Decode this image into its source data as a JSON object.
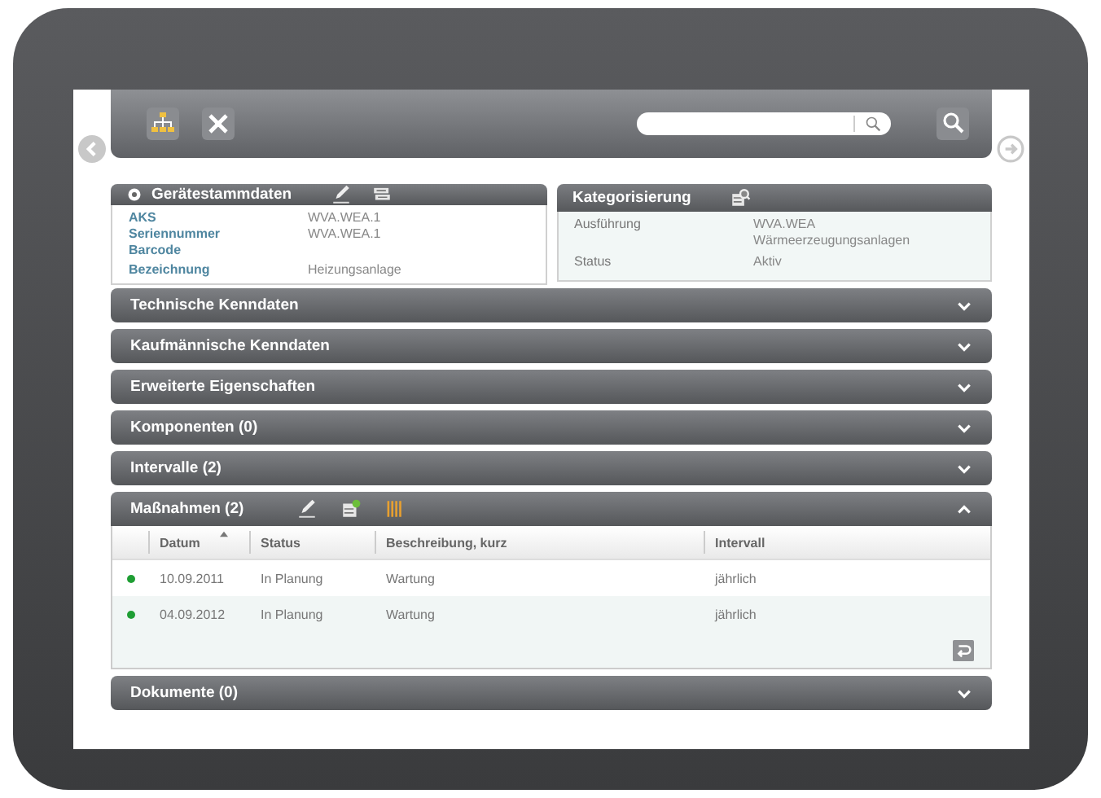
{
  "device_card": {
    "title": "Gerätestammdaten",
    "fields": [
      {
        "label": "AKS",
        "value": "WVA.WEA.1"
      },
      {
        "label": "Seriennummer",
        "value": "WVA.WEA.1"
      },
      {
        "label": "Barcode"
      },
      {
        "label": "Bezeichnung",
        "value": "Heizungsanlage"
      }
    ]
  },
  "category_card": {
    "title": "Kategorisierung",
    "fields": [
      {
        "label": "Ausführung",
        "value": "WVA.WEA\nWärmeerzeugungsanlagen"
      },
      {
        "label": "Status",
        "value": "Aktiv"
      }
    ]
  },
  "sections": [
    {
      "title": "Technische Kenndaten",
      "expanded": false
    },
    {
      "title": "Kaufmännische Kenndaten",
      "expanded": false
    },
    {
      "title": "Erweiterte Eigenschaften",
      "expanded": false
    },
    {
      "title": "Komponenten (0)",
      "expanded": false
    },
    {
      "title": "Intervalle (2)",
      "expanded": false
    },
    {
      "title": "Maßnahmen (2)",
      "expanded": true,
      "table": {
        "columns": [
          {
            "label": "Datum",
            "sorted": true
          },
          {
            "label": "Status",
            "sorted": false
          },
          {
            "label": "Beschreibung, kurz",
            "sorted": false
          },
          {
            "label": "Intervall",
            "sorted": false
          }
        ],
        "rows": [
          {
            "color": "#1f9e34",
            "cells": [
              "10.09.2011",
              "In Planung",
              "Wartung",
              "jährlich"
            ]
          },
          {
            "color": "#1f9e34",
            "cells": [
              "04.09.2012",
              "In Planung",
              "Wartung",
              "jährlich"
            ]
          }
        ]
      }
    },
    {
      "title": "Dokumente (0)",
      "expanded": false
    }
  ]
}
